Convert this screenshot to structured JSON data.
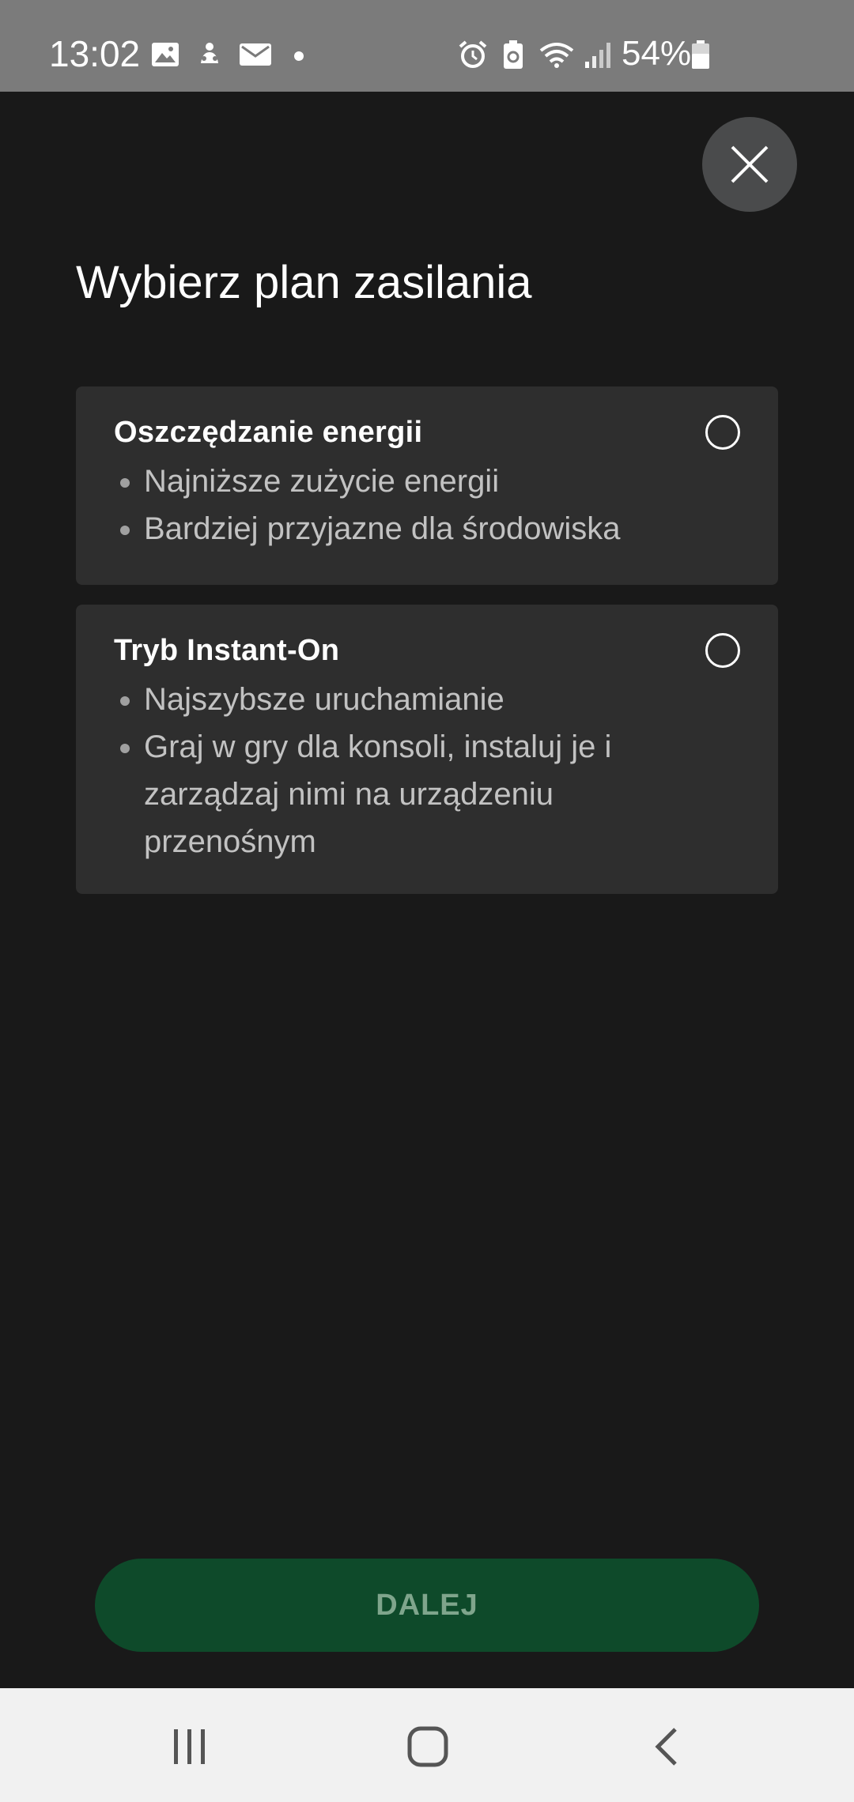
{
  "status_bar": {
    "time": "13:02",
    "battery_text": "54%",
    "icons": [
      "gallery-icon",
      "notification-icon",
      "mail-icon",
      "dot-icon",
      "alarm-icon",
      "battery-saver-icon",
      "wifi-icon",
      "signal-icon",
      "battery-icon"
    ]
  },
  "dialog": {
    "title": "Wybierz plan zasilania",
    "close_icon": "close-icon",
    "options": [
      {
        "title": "Oszczędzanie energii",
        "bullets": [
          "Najniższe zużycie energii",
          "Bardziej przyjazne dla środowiska"
        ],
        "selected": false
      },
      {
        "title": "Tryb Instant-On",
        "bullets": [
          "Najszybsze uruchamianie",
          "Graj w gry dla konsoli, instaluj je i zarządzaj nimi na urządzeniu przenośnym"
        ],
        "selected": false
      }
    ],
    "next_button": "DALEJ"
  },
  "nav_bar": {
    "icons": [
      "recent-apps-icon",
      "home-icon",
      "back-icon"
    ]
  },
  "colors": {
    "background": "#191919",
    "card": "#2e2e2e",
    "button": "#0e4a2a",
    "button_text": "#7fa58c",
    "status_bar": "#7b7b7b"
  }
}
